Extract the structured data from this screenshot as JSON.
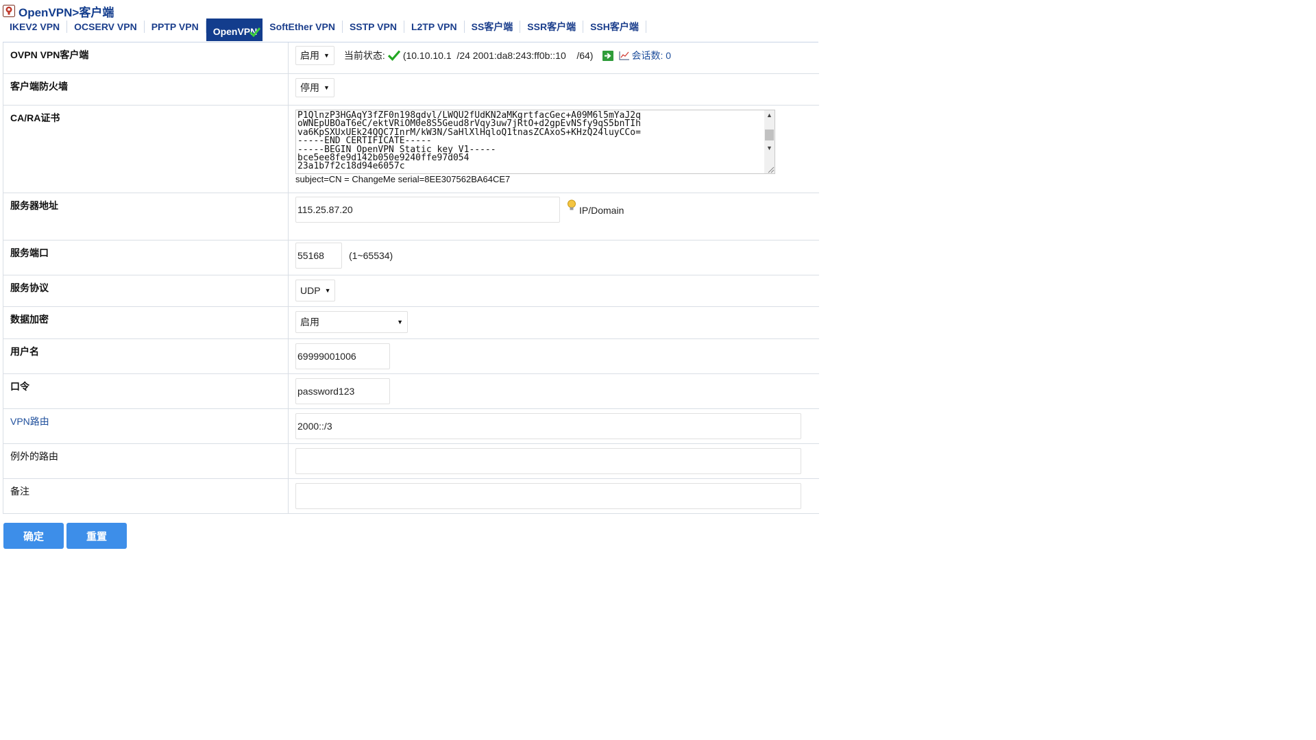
{
  "header": {
    "title": "OpenVPN>客户端",
    "icon": "openvpn-logo-icon"
  },
  "tabs": [
    {
      "label": "IKEV2 VPN",
      "active": false
    },
    {
      "label": "OCSERV VPN",
      "active": false
    },
    {
      "label": "PPTP VPN",
      "active": false
    },
    {
      "label": "OpenVPN",
      "active": true
    },
    {
      "label": "SoftEther VPN",
      "active": false
    },
    {
      "label": "SSTP VPN",
      "active": false
    },
    {
      "label": "L2TP VPN",
      "active": false
    },
    {
      "label": "SS客户端",
      "active": false
    },
    {
      "label": "SSR客户端",
      "active": false
    },
    {
      "label": "SSH客户端",
      "active": false
    }
  ],
  "form": {
    "ovpn_client": {
      "label": "OVPN VPN客户端",
      "select_value": "启用",
      "status_label": "当前状态:",
      "status_addr": "(10.10.10.1  /24 2001:da8:243:ff0b::10    /64)",
      "session_label": "会话数: 0"
    },
    "firewall": {
      "label": "客户端防火墙",
      "select_value": "停用"
    },
    "ca_cert": {
      "label": "CA/RA证书",
      "text": "P1QlnzP3HGAqY3fZF0n198qdvl/LWQU2fUdKN2aMKgrtfacGec+A09M6l5mYaJ2q\noWNEpUBOaT6eC/ektVRiOM0e8S5Geud8rVqy3uw7jRtO+d2gpEvNSfy9qS5bnTIh\nva6KpSXUxUEk24QQC7InrM/kW3N/SaHlXlHqloQ1tnasZCAxoS+KHzQ24luyCCo=\n-----END CERTIFICATE-----\n-----BEGIN OpenVPN Static key V1-----\nbce5ee8fe9d142b050e9240ffe97d054\n23a1b7f2c18d94e6057c",
      "subject": "subject=CN = ChangeMe serial=8EE307562BA64CE7"
    },
    "server_addr": {
      "label": "服务器地址",
      "value": "115.25.87.20",
      "hint": "IP/Domain"
    },
    "server_port": {
      "label": "服务端口",
      "value": "55168",
      "hint": "(1~65534)"
    },
    "protocol": {
      "label": "服务协议",
      "select_value": "UDP"
    },
    "encryption": {
      "label": "数据加密",
      "select_value": "启用"
    },
    "username": {
      "label": "用户名",
      "value": "69999001006"
    },
    "password": {
      "label": "口令",
      "value": "password123"
    },
    "vpn_route": {
      "label": "VPN路由",
      "value": "2000::/3"
    },
    "except_route": {
      "label": "例外的路由",
      "value": ""
    },
    "remark": {
      "label": "备注",
      "value": ""
    }
  },
  "buttons": {
    "confirm": "确定",
    "reset": "重置"
  },
  "colors": {
    "brand": "#133d8d",
    "button": "#3d8ee9",
    "check": "#22a722",
    "link": "#1f4f9c"
  }
}
